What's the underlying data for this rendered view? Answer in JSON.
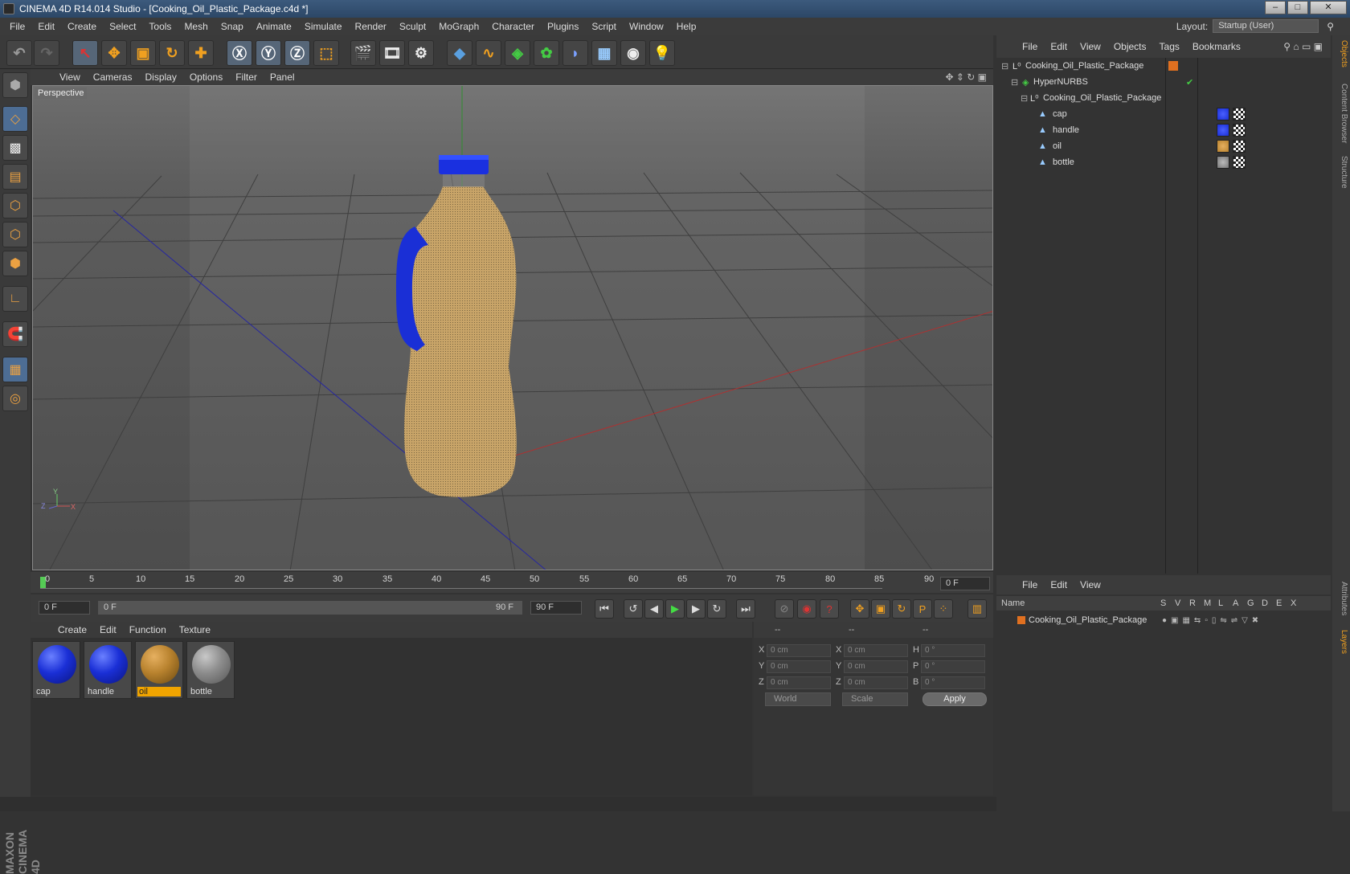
{
  "window": {
    "title": "CINEMA 4D R14.014 Studio - [Cooking_Oil_Plastic_Package.c4d *]"
  },
  "menubar": [
    "File",
    "Edit",
    "Create",
    "Select",
    "Tools",
    "Mesh",
    "Snap",
    "Animate",
    "Simulate",
    "Render",
    "Sculpt",
    "MoGraph",
    "Character",
    "Plugins",
    "Script",
    "Window",
    "Help"
  ],
  "layout": {
    "label": "Layout:",
    "value": "Startup (User)"
  },
  "viewport": {
    "menu": [
      "View",
      "Cameras",
      "Display",
      "Options",
      "Filter",
      "Panel"
    ],
    "label": "Perspective",
    "axis": {
      "x": "X",
      "y": "Y",
      "z": "Z"
    }
  },
  "timeline": {
    "ticks": [
      "0",
      "5",
      "10",
      "15",
      "20",
      "25",
      "30",
      "35",
      "40",
      "45",
      "50",
      "55",
      "60",
      "65",
      "70",
      "75",
      "80",
      "85",
      "90"
    ],
    "end_field": "0 F"
  },
  "controls": {
    "current_frame": "0 F",
    "range_start": "0 F",
    "range_end": "90 F",
    "max_frame": "90 F"
  },
  "materials": {
    "menu": [
      "Create",
      "Edit",
      "Function",
      "Texture"
    ],
    "items": [
      {
        "label": "cap",
        "color": "#1a2fd6"
      },
      {
        "label": "handle",
        "color": "#1a2fd6"
      },
      {
        "label": "oil",
        "color": "#b8822e",
        "selected": true
      },
      {
        "label": "bottle",
        "color": "#8c8c8c"
      }
    ]
  },
  "coordinates": {
    "headers": [
      "--",
      "--",
      "--"
    ],
    "rows": [
      {
        "a": "X",
        "av": "0 cm",
        "b": "X",
        "bv": "0 cm",
        "c": "H",
        "cv": "0 °"
      },
      {
        "a": "Y",
        "av": "0 cm",
        "b": "Y",
        "bv": "0 cm",
        "c": "P",
        "cv": "0 °"
      },
      {
        "a": "Z",
        "av": "0 cm",
        "b": "Z",
        "bv": "0 cm",
        "c": "B",
        "cv": "0 °"
      }
    ],
    "mode": "World",
    "transform": "Scale",
    "apply": "Apply"
  },
  "objects": {
    "menu": [
      "File",
      "Edit",
      "View",
      "Objects",
      "Tags",
      "Bookmarks"
    ],
    "tree": [
      {
        "name": "Cooking_Oil_Plastic_Package"
      },
      {
        "name": "HyperNURBS"
      },
      {
        "name": "Cooking_Oil_Plastic_Package"
      },
      {
        "name": "cap"
      },
      {
        "name": "handle"
      },
      {
        "name": "oil"
      },
      {
        "name": "bottle"
      }
    ]
  },
  "layers": {
    "menu": [
      "File",
      "Edit",
      "View"
    ],
    "columns": [
      "Name",
      "S",
      "V",
      "R",
      "M",
      "L",
      "A",
      "G",
      "D",
      "E",
      "X"
    ],
    "rows": [
      {
        "name": "Cooking_Oil_Plastic_Package"
      }
    ]
  },
  "sidetabs": [
    "Objects",
    "Content Browser",
    "Structure",
    "Attributes",
    "Layers"
  ],
  "brand": {
    "line1": "MAXON",
    "line2": "CINEMA 4D"
  }
}
